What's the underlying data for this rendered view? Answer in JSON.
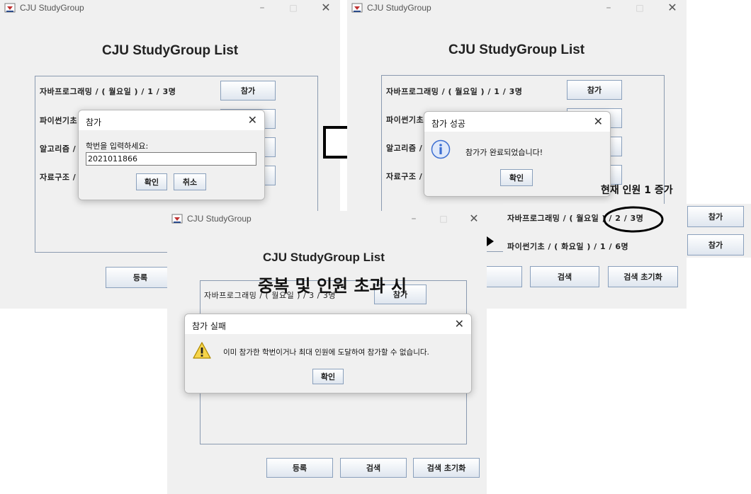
{
  "window_title": "CJU StudyGroup",
  "app_title": "CJU StudyGroup List",
  "join_label": "참가",
  "buttons": {
    "register": "등록",
    "search": "검색",
    "search_reset": "검색 초기화",
    "ok": "확인",
    "cancel": "취소"
  },
  "win1": {
    "rows": [
      "자바프로그래밍 / ( 월요일 ) / 1 / 3명",
      "파이썬기초 /",
      "알고리즘 /",
      "자료구조 /"
    ],
    "dialog": {
      "title": "참가",
      "prompt": "학번을 입력하세요:",
      "input_value": "2021011866"
    }
  },
  "win2": {
    "rows": [
      "자바프로그래밍 / ( 월요일 ) / 1 / 3명",
      "파이썬기초 /",
      "알고리즘 /",
      "자료구조 /"
    ],
    "dialog": {
      "title": "참가 성공",
      "message": "참가가 완료되었습니다!"
    },
    "zoom_rows": [
      "자바프로그래밍 / ( 월요일 ) / 2 / 3명",
      "파이썬기초 / ( 화요일 ) / 1 / 6명"
    ],
    "annotation": "현재 인원 1 증가",
    "register_partial": "록"
  },
  "win3": {
    "rows": [
      "자바프로그래밍 / ( 월요일 ) / 3 / 3명"
    ],
    "dialog": {
      "title": "참가 실패",
      "message": "이미 참가한 학번이거나 최대 인원에 도달하여 참가할 수 없습니다."
    },
    "overlay": "중복 및 인원 초과 시"
  },
  "colors": {
    "window_bg": "#f0f0f0",
    "button_border": "#8aa0bc",
    "info_icon": "#3d6fd1",
    "warning_icon": "#e0b400"
  },
  "icons": {
    "window": "java-cup-icon",
    "info": "info-icon",
    "warning": "warning-icon",
    "arrow": "right-arrow-icon"
  }
}
